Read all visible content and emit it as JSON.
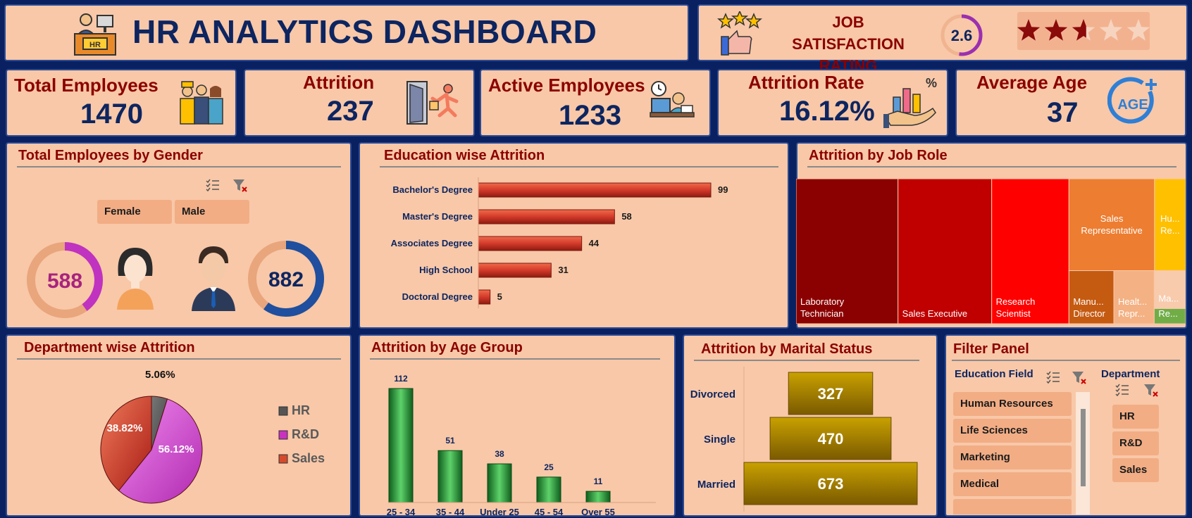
{
  "header": {
    "title": "HR ANALYTICS DASHBOARD",
    "icon_label": "HR"
  },
  "satisfaction": {
    "title_line1": "JOB SATISFACTION",
    "title_line2": "RATING",
    "value": "2.6",
    "max_stars": 5,
    "rating_fraction": 0.52
  },
  "kpis": {
    "total_employees": {
      "label": "Total Employees",
      "value": "1470"
    },
    "attrition": {
      "label": "Attrition",
      "value": "237"
    },
    "active_employees": {
      "label": "Active Employees",
      "value": "1233"
    },
    "attrition_rate": {
      "label": "Attrition Rate",
      "value": "16.12%"
    },
    "average_age": {
      "label": "Average Age",
      "value": "37",
      "icon_text": "AGE"
    }
  },
  "gender": {
    "title": "Total Employees by Gender",
    "slicer": [
      "Female",
      "Male"
    ],
    "female": {
      "value": "588",
      "fraction": 0.4
    },
    "male": {
      "value": "882",
      "fraction": 0.6
    }
  },
  "education": {
    "title": "Education wise Attrition"
  },
  "jobrole": {
    "title": "Attrition by Job Role"
  },
  "department": {
    "title": "Department wise Attrition"
  },
  "agegroup": {
    "title": "Attrition by Age Group"
  },
  "marital": {
    "title": "Attrition by Marital Status"
  },
  "filter": {
    "title": "Filter Panel",
    "education_field": {
      "label": "Education Field",
      "items": [
        "Human Resources",
        "Life Sciences",
        "Marketing",
        "Medical"
      ]
    },
    "department": {
      "label": "Department",
      "items": [
        "HR",
        "R&D",
        "Sales"
      ]
    }
  },
  "chart_data": [
    {
      "type": "bar",
      "orientation": "horizontal",
      "title": "Education wise Attrition",
      "categories": [
        "Bachelor's Degree",
        "Master's Degree",
        "Associates Degree",
        "High School",
        "Doctoral Degree"
      ],
      "values": [
        99,
        58,
        44,
        31,
        5
      ],
      "color": "#c0392b"
    },
    {
      "type": "treemap",
      "title": "Attrition by Job Role",
      "labels": [
        "Laboratory Technician",
        "Sales Executive",
        "Research Scientist",
        "Sales Representative",
        "Human Resources",
        "Manufacturing Director",
        "Healthcare Representative",
        "Manager",
        "Research Director"
      ],
      "display": [
        "Laboratory\nTechnician",
        "Sales Executive",
        "Research\nScientist",
        "Sales\nRepresentative",
        "Hu...\nRe...",
        "Manu...\nDirector",
        "Healt...\nRepr...",
        "Ma...",
        "Re..."
      ],
      "values": [
        62,
        57,
        47,
        33,
        12,
        10,
        9,
        5,
        2
      ],
      "colors": [
        "#8b0000",
        "#c00000",
        "#ff0000",
        "#ed7d31",
        "#ffc000",
        "#c55a11",
        "#f4b183",
        "#f8cbad",
        "#70ad47"
      ]
    },
    {
      "type": "pie",
      "title": "Department wise Attrition",
      "labels": [
        "HR",
        "R&D",
        "Sales"
      ],
      "values": [
        5.06,
        56.12,
        38.82
      ],
      "display": [
        "5.06%",
        "56.12%",
        "38.82%"
      ],
      "colors": [
        "#555555",
        "#c832c0",
        "#d64a2c"
      ],
      "legend": "right"
    },
    {
      "type": "bar",
      "title": "Attrition by Age Group",
      "categories": [
        "25 - 34",
        "35 - 44",
        "Under 25",
        "45 - 54",
        "Over 55"
      ],
      "values": [
        112,
        51,
        38,
        25,
        11
      ],
      "color": "#1f8a2f"
    },
    {
      "type": "bar",
      "orientation": "horizontal",
      "subtype": "funnel",
      "title": "Attrition by Marital Status",
      "categories": [
        "Divorced",
        "Single",
        "Married"
      ],
      "values": [
        327,
        470,
        673
      ],
      "color": "#b08800"
    }
  ]
}
